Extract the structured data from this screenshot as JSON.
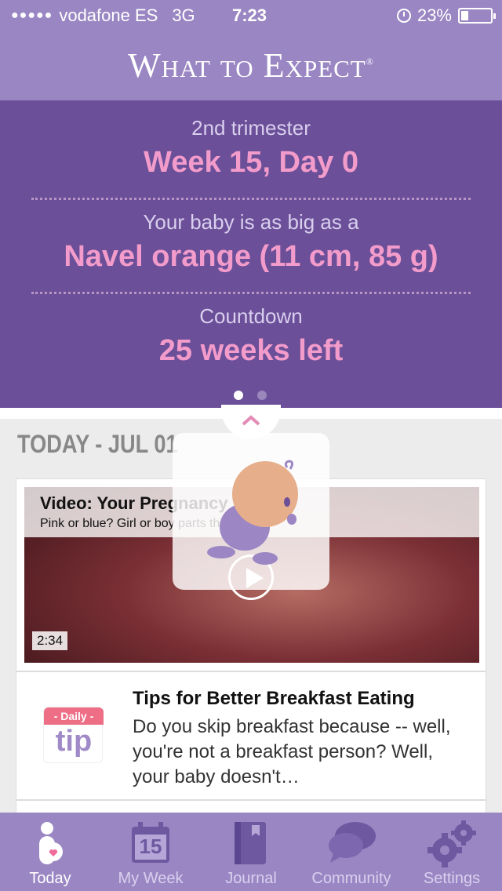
{
  "status": {
    "carrier": "vodafone ES",
    "network": "3G",
    "time": "7:23",
    "battery": "23%",
    "signal_dots": "●●●●●"
  },
  "header": {
    "logo": "What to Expect",
    "logo_mark": "®"
  },
  "info": {
    "trimester": "2nd trimester",
    "week": "Week 15, Day 0",
    "size_label": "Your baby is as big as a",
    "size_value": "Navel orange (11 cm, 85 g)",
    "countdown_label": "Countdown",
    "countdown_value": "25 weeks left"
  },
  "collapse_icon": "chevron-up",
  "section": {
    "title": "TODAY - JUL 01"
  },
  "video": {
    "title": "Video: Your Pregnancy 15",
    "subtitle": "Pink or blue? Girl or boy parts this week!",
    "duration": "2:34"
  },
  "tip": {
    "badge": "- Daily -",
    "badge_word": "tip",
    "title": "Tips for Better Breakfast Eating",
    "body": "Do you skip breakfast because -- well, you're not a breakfast person? Well, your baby doesn't…"
  },
  "tabs": [
    {
      "label": "Today",
      "icon": "mom-icon"
    },
    {
      "label": "My Week",
      "icon": "calendar-icon",
      "icon_text": "15"
    },
    {
      "label": "Journal",
      "icon": "journal-icon"
    },
    {
      "label": "Community",
      "icon": "chat-bubbles-icon"
    },
    {
      "label": "Settings",
      "icon": "gears-icon"
    }
  ],
  "colors": {
    "header": "#9a86c3",
    "panel": "#6b4f98",
    "accent_pink": "#f39ccb"
  }
}
